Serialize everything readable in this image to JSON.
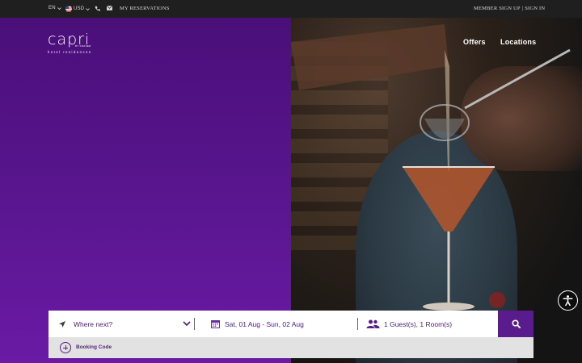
{
  "topbar": {
    "language": "EN",
    "currency": "USD",
    "reservations": "MY RESERVATIONS",
    "member_signup": "MEMBER SIGN UP",
    "separator": "|",
    "sign_in": "SIGN IN"
  },
  "brand": {
    "logo_word": "capri",
    "logo_by": "BY FRASER",
    "logo_sub": "hotel residences"
  },
  "nav": {
    "offers": "Offers",
    "locations": "Locations"
  },
  "booking": {
    "destination_placeholder": "Where next?",
    "dates": "Sat, 01 Aug - Sun, 02 Aug",
    "guests": "1 Guest(s), 1 Room(s)",
    "booking_code": "Booking Code"
  },
  "colors": {
    "brand_purple": "#5a1b8c",
    "hero_purple": "#4a0f79"
  }
}
